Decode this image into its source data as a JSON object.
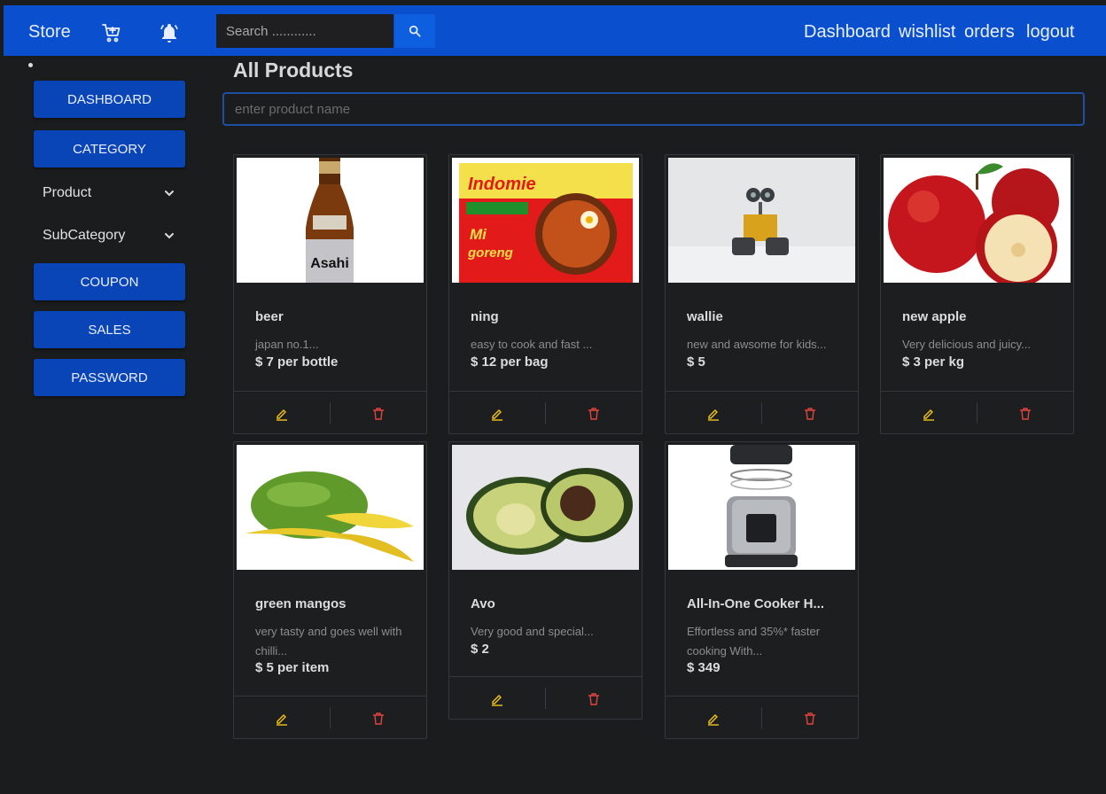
{
  "navbar": {
    "brand": "Store",
    "search_placeholder": "Search ............",
    "links": [
      "Dashboard",
      "wishlist",
      "orders",
      "logout"
    ]
  },
  "sidebar": {
    "buttons": [
      "DASHBOARD",
      "CATEGORY",
      "COUPON",
      "SALES",
      "PASSWORD"
    ],
    "dropdowns": [
      "Product",
      "SubCategory"
    ]
  },
  "main": {
    "title": "All Products",
    "search_placeholder": "enter product name"
  },
  "products": [
    {
      "name": "beer",
      "desc": "japan no.1...",
      "price": "$ 7 per bottle",
      "image": "asahi-beer-bottle"
    },
    {
      "name": "ning",
      "desc": "easy to cook and fast ...",
      "price": "$ 12 per bag",
      "image": "indomie-noodles-pack"
    },
    {
      "name": "wallie",
      "desc": "new and awsome for kids...",
      "price": "$ 5",
      "image": "wall-e-robot-toy"
    },
    {
      "name": "new apple",
      "desc": "Very delicious and juicy...",
      "price": "$ 3 per kg",
      "image": "red-apples"
    },
    {
      "name": "green mangos",
      "desc": "very tasty and goes well with chilli...",
      "price": "$ 5 per item",
      "image": "sliced-green-mango"
    },
    {
      "name": "Avo",
      "desc": "Very good and special...",
      "price": "$ 2",
      "image": "halved-avocado"
    },
    {
      "name": "All-In-One Cooker H...",
      "desc": "Effortless and 35%* faster cooking With...",
      "price": "$ 349",
      "image": "pressure-cooker"
    }
  ],
  "colors": {
    "navbar": "#0a4fce",
    "sidebar_button": "#0a45b8",
    "background": "#1b1c1e",
    "edit_icon": "#f2c21b",
    "delete_icon": "#e0443e"
  }
}
